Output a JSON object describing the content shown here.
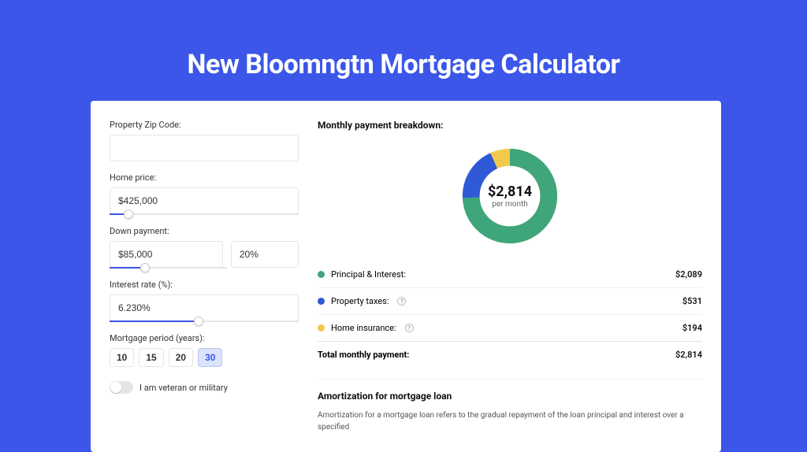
{
  "title": "New Bloomngtn Mortgage Calculator",
  "colors": {
    "pi": "#3fa57a",
    "tax": "#2f59d6",
    "ins": "#f2c94c"
  },
  "form": {
    "zip_label": "Property Zip Code:",
    "zip_value": "",
    "home_price_label": "Home price:",
    "home_price_value": "$425,000",
    "home_price_slider_pct": 10,
    "down_payment_label": "Down payment:",
    "down_payment_value": "$85,000",
    "down_payment_pct_value": "20%",
    "down_payment_slider_pct": 30,
    "rate_label": "Interest rate (%):",
    "rate_value": "6.230%",
    "rate_slider_pct": 47,
    "period_label": "Mortgage period (years):",
    "periods": [
      "10",
      "15",
      "20",
      "30"
    ],
    "period_selected": "30",
    "veteran_label": "I am veteran or military",
    "veteran_on": false
  },
  "breakdown": {
    "heading": "Monthly payment breakdown:",
    "total_display": "$2,814",
    "total_sub": "per month",
    "items": [
      {
        "label": "Principal & Interest:",
        "value": "$2,089",
        "colorKey": "pi",
        "info": false
      },
      {
        "label": "Property taxes:",
        "value": "$531",
        "colorKey": "tax",
        "info": true
      },
      {
        "label": "Home insurance:",
        "value": "$194",
        "colorKey": "ins",
        "info": true
      }
    ],
    "total_label": "Total monthly payment:",
    "total_value": "$2,814"
  },
  "amortization": {
    "title": "Amortization for mortgage loan",
    "body": "Amortization for a mortgage loan refers to the gradual repayment of the loan principal and interest over a specified"
  },
  "chart_data": {
    "type": "pie",
    "title": "Monthly payment breakdown",
    "series": [
      {
        "name": "Principal & Interest",
        "value": 2089,
        "color": "#3fa57a"
      },
      {
        "name": "Property taxes",
        "value": 531,
        "color": "#2f59d6"
      },
      {
        "name": "Home insurance",
        "value": 194,
        "color": "#f2c94c"
      }
    ],
    "total": 2814
  }
}
